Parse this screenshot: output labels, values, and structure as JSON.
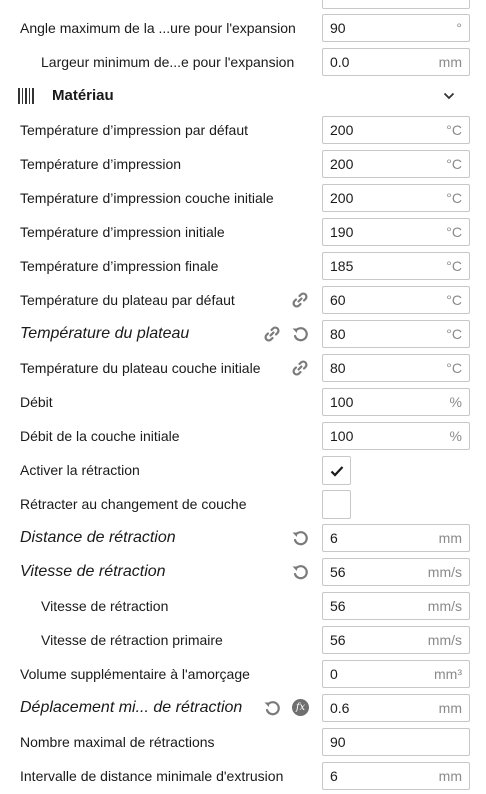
{
  "header": {
    "partial_row_label": "…",
    "angle_row": {
      "label": "Angle maximum de la ...ure pour l'expansion",
      "value": "90",
      "unit": "°"
    },
    "largeur_row": {
      "label": "Largeur minimum de...e pour l'expansion",
      "value": "0.0",
      "unit": "mm"
    }
  },
  "section": {
    "title": "Matériau",
    "icon": "material-stripes-icon",
    "chevron": "chevron-down-icon"
  },
  "rows": [
    {
      "label": "Température d’impression par défaut",
      "value": "200",
      "unit": "°C"
    },
    {
      "label": "Température d’impression",
      "value": "200",
      "unit": "°C"
    },
    {
      "label": "Température d’impression couche initiale",
      "value": "200",
      "unit": "°C"
    },
    {
      "label": "Température d’impression initiale",
      "value": "190",
      "unit": "°C"
    },
    {
      "label": "Température d’impression finale",
      "value": "185",
      "unit": "°C"
    },
    {
      "label": "Température du plateau par défaut",
      "value": "60",
      "unit": "°C"
    },
    {
      "label": "Température du plateau",
      "value": "80",
      "unit": "°C"
    },
    {
      "label": "Température du plateau couche initiale",
      "value": "80",
      "unit": "°C"
    },
    {
      "label": "Débit",
      "value": "100",
      "unit": "%"
    },
    {
      "label": "Débit de la couche initiale",
      "value": "100",
      "unit": "%"
    },
    {
      "label": "Activer la rétraction",
      "checked": true
    },
    {
      "label": "Rétracter au changement de couche",
      "checked": false
    },
    {
      "label": "Distance de rétraction",
      "value": "6",
      "unit": "mm"
    },
    {
      "label": "Vitesse de rétraction",
      "value": "56",
      "unit": "mm/s"
    },
    {
      "label": "Vitesse de rétraction",
      "value": "56",
      "unit": "mm/s"
    },
    {
      "label": "Vitesse de rétraction primaire",
      "value": "56",
      "unit": "mm/s"
    },
    {
      "label": "Volume supplémentaire à l'amorçage",
      "value": "0",
      "unit": "mm³"
    },
    {
      "label": "Déplacement mi... de rétraction",
      "value": "0.6",
      "unit": "mm"
    },
    {
      "label": "Nombre maximal de rétractions",
      "value": "90",
      "unit": ""
    },
    {
      "label": "Intervalle de distance minimale d'extrusion",
      "value": "6",
      "unit": "mm"
    }
  ],
  "icons": {
    "link": "link-icon",
    "reset": "reset-icon",
    "fx": "fx-icon",
    "fx_glyph": "fx",
    "check": "checkmark-icon"
  },
  "colors": {
    "icon_gray": "#7a7a7a",
    "border": "#c8c8c8",
    "unit_gray": "#8a8a8a"
  }
}
